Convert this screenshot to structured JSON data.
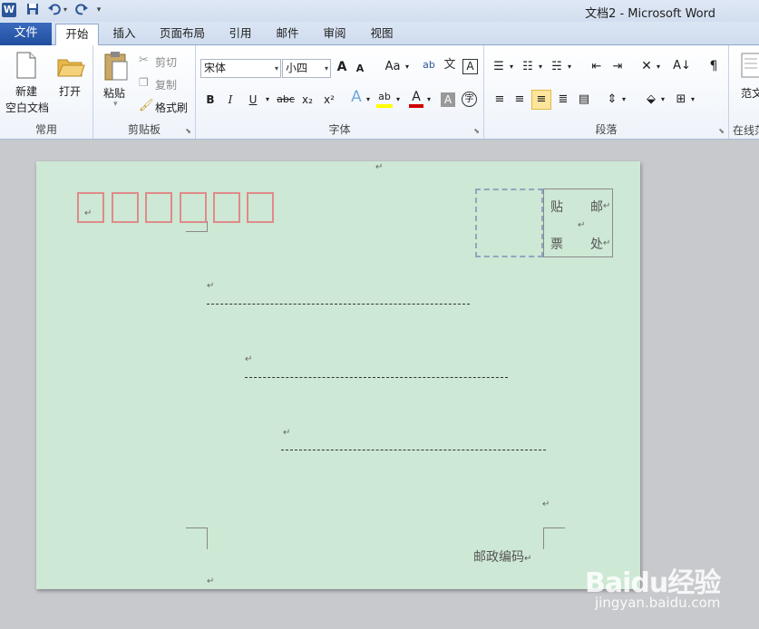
{
  "titlebar": {
    "app_icon": "W",
    "title": "文档2 - Microsoft Word"
  },
  "tabs": {
    "file": "文件",
    "items": [
      "开始",
      "插入",
      "页面布局",
      "引用",
      "邮件",
      "审阅",
      "视图"
    ],
    "active_index": 0
  },
  "ribbon": {
    "common": {
      "new_label_1": "新建",
      "new_label_2": "空白文档",
      "open_label": "打开",
      "group_label": "常用"
    },
    "clipboard": {
      "paste_label": "粘贴",
      "cut_label": "剪切",
      "copy_label": "复制",
      "format_painter_label": "格式刷",
      "group_label": "剪贴板"
    },
    "font": {
      "font_name": "宋体",
      "font_size": "小四",
      "grow": "A",
      "shrink": "A",
      "change_case": "Aa",
      "wen": "文",
      "bold": "B",
      "italic": "I",
      "underline": "U",
      "strike": "abc",
      "subscript": "x₂",
      "superscript": "x²",
      "text_effect": "A",
      "highlight": "ab",
      "font_color": "A",
      "char_shading": "A",
      "enclose": "字",
      "group_label": "字体"
    },
    "paragraph": {
      "group_label": "段落"
    },
    "extra": {
      "templates_label": "范文",
      "online_label": "在线范"
    }
  },
  "document": {
    "stamp_chars": [
      "贴",
      "邮",
      "票",
      "处"
    ],
    "postal_code_label": "邮政编码",
    "para_mark": "↵"
  },
  "watermark": {
    "logo": "Baidu经验",
    "url": "jingyan.baidu.com"
  },
  "colors": {
    "page_bg": "#cde8d4",
    "zip_box_border": "#e08a8a",
    "file_tab": "#2b5797",
    "stamp_dashed": "#8ea6c0"
  }
}
